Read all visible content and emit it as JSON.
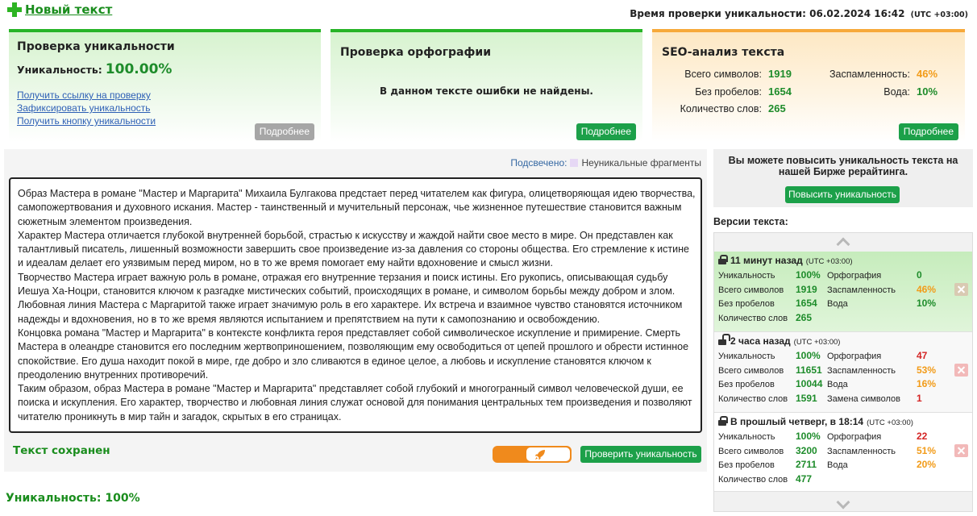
{
  "header": {
    "new_text_label": "Новый текст",
    "check_time_label": "Время проверки уникальности:",
    "check_time_value": "06.02.2024 16:42",
    "check_time_tz": "(UTC +03:00)"
  },
  "cards": {
    "uniqueness": {
      "title": "Проверка уникальности",
      "label": "Уникальность:",
      "value": "100.00%",
      "links": [
        "Получить ссылку на проверку",
        "Зафиксировать уникальность",
        "Получить кнопку уникальности"
      ],
      "more_button": "Подробнее"
    },
    "spelling": {
      "title": "Проверка орфографии",
      "message": "В данном тексте ошибки не найдены.",
      "more_button": "Подробнее"
    },
    "seo": {
      "title": "SEO-анализ текста",
      "left_stats": [
        {
          "label": "Всего символов:",
          "value": "1919"
        },
        {
          "label": "Без пробелов:",
          "value": "1654"
        },
        {
          "label": "Количество слов:",
          "value": "265"
        }
      ],
      "right_stats": [
        {
          "label": "Заспамленность:",
          "value": "46%"
        },
        {
          "label": "Вода:",
          "value": "10%"
        }
      ],
      "more_button": "Подробнее"
    }
  },
  "highlight": {
    "label": "Подсвечено:",
    "legend": "Неуникальные фрагменты"
  },
  "article": {
    "paragraphs": [
      "Образ Мастера в романе \"Мастер и Маргарита\" Михаила Булгакова предстает перед читателем как фигура, олицетворяющая идею творчества, самопожертвования и духовного искания. Мастер - таинственный и мучительный персонаж, чье жизненное путешествие становится важным сюжетным элементом произведения.",
      "Характер Мастера отличается глубокой внутренней борьбой, страстью к искусству и жаждой найти свое место в мире. Он представлен как талантливый писатель, лишенный возможности завершить свое произведение из-за давления со стороны общества. Его стремление к истине и идеалам делает его уязвимым перед миром, но в то же время помогает ему найти вдохновение и смысл жизни.",
      "Творчество Мастера играет важную роль в романе, отражая его внутренние терзания и поиск истины. Его рукопись, описывающая судьбу Иешуа Ха-Ноцри, становится ключом к разгадке мистических событий, происходящих в романе, и символом борьбы между добром и злом.",
      "Любовная линия Мастера с Маргаритой также играет значимую роль в его характере. Их встреча и взаимное чувство становятся источником надежды и вдохновения, но в то же время являются испытанием и препятствием на пути к самопознанию и освобождению.",
      "Концовка романа \"Мастер и Маргарита\" в контексте конфликта героя представляет собой символическое искупление и примирение. Смерть Мастера в олеандре становится его последним жертвоприношением, позволяющим ему освободиться от цепей прошлого и обрести истинное спокойствие. Его душа находит покой в мире, где добро и зло сливаются в единое целое, а любовь и искупление становятся ключом к преодолению внутренних противоречий.",
      "Таким образом, образ Мастера в романе \"Мастер и Маргарита\" представляет собой глубокий и многогранный символ человеческой души, ее поиска и искупления. Его характер, творчество и любовная линия служат основой для понимания центральных тем произведения и позволяют читателю проникнуть в мир тайн и загадок, скрытых в его страницах."
    ]
  },
  "status": {
    "saved": "Текст сохранен",
    "uniqueness": "Уникальность: 100%"
  },
  "actions": {
    "check_button": "Проверить уникальность",
    "toggle_icon": "rocket-icon"
  },
  "promo": {
    "text": "Вы можете повысить уникальность текста на нашей Бирже рерайтинга.",
    "button": "Повысить уникальность"
  },
  "versions": {
    "title": "Версии текста:",
    "items": [
      {
        "current": true,
        "lock_icon": "lock-icon",
        "time": "11 минут назад",
        "tz": "(UTC +03:00)",
        "rows": [
          {
            "l1": "Уникальность",
            "v1": "100%",
            "c1": "green",
            "l2": "Орфография",
            "v2": "0",
            "c2": "green"
          },
          {
            "l1": "Всего символов",
            "v1": "1919",
            "c1": "green",
            "l2": "Заспамленность",
            "v2": "46%",
            "c2": "orange"
          },
          {
            "l1": "Без пробелов",
            "v1": "1654",
            "c1": "green",
            "l2": "Вода",
            "v2": "10%",
            "c2": "green"
          },
          {
            "l1": "Количество слов",
            "v1": "265",
            "c1": "green"
          }
        ]
      },
      {
        "current": false,
        "lock_icon": "unlock-icon",
        "time": "2 часа назад",
        "tz": "(UTC +03:00)",
        "rows": [
          {
            "l1": "Уникальность",
            "v1": "100%",
            "c1": "green",
            "l2": "Орфография",
            "v2": "47",
            "c2": "red"
          },
          {
            "l1": "Всего символов",
            "v1": "11651",
            "c1": "green",
            "l2": "Заспамленность",
            "v2": "53%",
            "c2": "orange"
          },
          {
            "l1": "Без пробелов",
            "v1": "10044",
            "c1": "green",
            "l2": "Вода",
            "v2": "16%",
            "c2": "orange"
          },
          {
            "l1": "Количество слов",
            "v1": "1591",
            "c1": "green",
            "l2": "Замена символов",
            "v2": "1",
            "c2": "red"
          }
        ]
      },
      {
        "current": false,
        "lock_icon": "lock-icon",
        "time": "В прошлый четверг, в 18:14",
        "tz": "(UTC +03:00)",
        "rows": [
          {
            "l1": "Уникальность",
            "v1": "100%",
            "c1": "green",
            "l2": "Орфография",
            "v2": "22",
            "c2": "red"
          },
          {
            "l1": "Всего символов",
            "v1": "3200",
            "c1": "green",
            "l2": "Заспамленность",
            "v2": "51%",
            "c2": "orange"
          },
          {
            "l1": "Без пробелов",
            "v1": "2711",
            "c1": "green",
            "l2": "Вода",
            "v2": "20%",
            "c2": "orange"
          },
          {
            "l1": "Количество слов",
            "v1": "477",
            "c1": "green"
          }
        ]
      }
    ]
  },
  "colors": {
    "accent_green": "#1ca049",
    "brand_green": "#1e8c2b",
    "warning_orange": "#f29b18",
    "error_red": "#d42424",
    "seo_accent": "#f7a93a"
  }
}
